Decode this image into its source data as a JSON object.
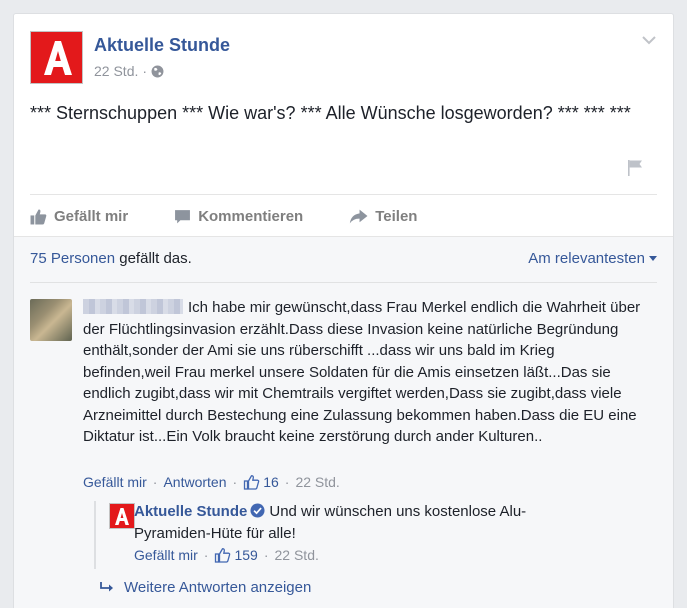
{
  "post": {
    "page_name": "Aktuelle Stunde",
    "time": "22 Std.",
    "separator": "·",
    "text": "*** Sternschuppen *** Wie war's? *** Alle Wünsche losgeworden? *** *** ***",
    "logo_letter": "A"
  },
  "actions": {
    "like": "Gefällt mir",
    "comment": "Kommentieren",
    "share": "Teilen"
  },
  "feedback": {
    "likes_link": "75 Personen",
    "likes_suffix": " gefällt das.",
    "sort_label": "Am relevantesten"
  },
  "comment": {
    "text": "Ich habe mir gewünscht,dass Frau Merkel endlich die Wahrheit über der Flüchtlingsinvasion erzählt.Dass diese Invasion keine natürliche Begründung enthält,sonder der Ami sie uns rüberschifft ...dass wir uns bald im Krieg befinden,weil Frau merkel unsere Soldaten für die Amis einsetzen läßt...Das sie endlich zugibt,dass wir mit Chemtrails vergiftet werden,Dass sie zugibt,dass viele Arzneimittel durch Bestechung eine Zulassung bekommen haben.Dass die EU eine Diktatur ist...Ein Volk braucht keine zerstörung durch ander Kulturen..",
    "like_label": "Gefällt mir",
    "reply_label": "Antworten",
    "like_count": "16",
    "time": "22 Std.",
    "dot": "·"
  },
  "reply": {
    "author": "Aktuelle Stunde",
    "text": "Und wir wünschen uns kostenlose Alu-Pyramiden-Hüte für alle!",
    "like_label": "Gefällt mir",
    "like_count": "159",
    "time": "22 Std.",
    "dot": "·",
    "logo_letter": "A"
  },
  "more_replies": "Weitere Antworten anzeigen",
  "colors": {
    "link": "#365899",
    "brand_red": "#e3191b",
    "muted": "#90949c",
    "verified": "#4267b2"
  },
  "icons": [
    "globe-icon",
    "chevron-down-icon",
    "flag-icon",
    "thumbs-up-icon",
    "comment-icon",
    "share-arrow-icon",
    "verified-badge-icon",
    "reply-arrow-icon"
  ]
}
